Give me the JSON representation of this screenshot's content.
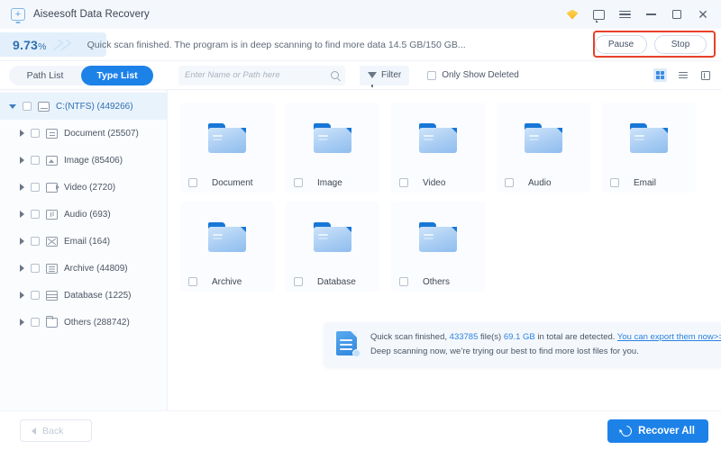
{
  "titlebar": {
    "app_title": "Aiseesoft Data Recovery",
    "logo_icon": "monitor-plus-icon",
    "icons": [
      {
        "name": "gem-icon",
        "label": "gem"
      },
      {
        "name": "feedback-icon",
        "label": "feedback"
      },
      {
        "name": "menu-icon",
        "label": "menu"
      },
      {
        "name": "minimize-icon",
        "label": "minimize"
      },
      {
        "name": "maximize-icon",
        "label": "maximize"
      },
      {
        "name": "close-icon",
        "label": "✕"
      }
    ]
  },
  "progress": {
    "percent_value": "9.73",
    "percent_unit": "%",
    "percent_fill": 9.73,
    "message": "Quick scan finished. The program is in deep scanning to find more data 14.5 GB/150 GB...",
    "pause_label": "Pause",
    "stop_label": "Stop",
    "highlight_color": "#e8402a"
  },
  "toolbar": {
    "segments": [
      {
        "label": "Path List",
        "active": false
      },
      {
        "label": "Type List",
        "active": true
      }
    ],
    "search_placeholder": "Enter Name or Path here",
    "search_value": "",
    "filter_label": "Filter",
    "only_show_deleted_label": "Only Show Deleted",
    "only_show_deleted_checked": false,
    "views": [
      {
        "name": "grid-view-icon",
        "active": true
      },
      {
        "name": "list-view-icon",
        "active": false
      },
      {
        "name": "detail-view-icon",
        "active": false
      }
    ]
  },
  "sidebar": {
    "root": {
      "label": "C:(NTFS) (449266)",
      "icon": "disk-icon",
      "expanded": true,
      "checked": false
    },
    "items": [
      {
        "label": "Document (25507)",
        "icon": "doc"
      },
      {
        "label": "Image (85406)",
        "icon": "img"
      },
      {
        "label": "Video (2720)",
        "icon": "vid"
      },
      {
        "label": "Audio (693)",
        "icon": "aud"
      },
      {
        "label": "Email (164)",
        "icon": "mail"
      },
      {
        "label": "Archive (44809)",
        "icon": "arc"
      },
      {
        "label": "Database (1225)",
        "icon": "db"
      },
      {
        "label": "Others (288742)",
        "icon": "fld"
      }
    ]
  },
  "content": {
    "cards": [
      {
        "label": "Document",
        "checked": false
      },
      {
        "label": "Image",
        "checked": false
      },
      {
        "label": "Video",
        "checked": false
      },
      {
        "label": "Audio",
        "checked": false
      },
      {
        "label": "Email",
        "checked": false
      },
      {
        "label": "Archive",
        "checked": false
      },
      {
        "label": "Database",
        "checked": false
      },
      {
        "label": "Others",
        "checked": false
      }
    ]
  },
  "toast": {
    "icon": "document-scan-icon",
    "line1_prefix": "Quick scan finished, ",
    "file_count": "433785",
    "line1_mid": " file(s) ",
    "total_size": "69.1 GB",
    "line1_suffix": " in total are detected. ",
    "link_label": "You can export them now>>",
    "line2": "Deep scanning now, we’re trying our best to find more lost files for you.",
    "close_label": "✕"
  },
  "footer": {
    "back_label": "Back",
    "recover_label": "Recover All",
    "recover_color": "#1d82e8"
  }
}
